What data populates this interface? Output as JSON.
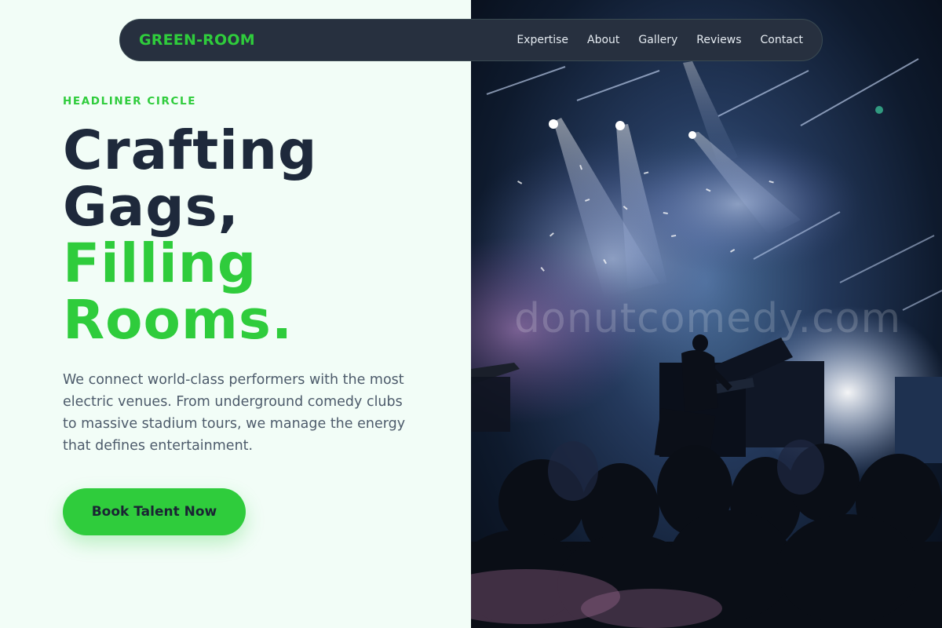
{
  "nav": {
    "logo": "GREEN-ROOM",
    "links": [
      "Expertise",
      "About",
      "Gallery",
      "Reviews",
      "Contact"
    ]
  },
  "hero": {
    "eyebrow": "HEADLINER CIRCLE",
    "headline_dark": [
      "Crafting",
      "Gags,"
    ],
    "headline_green": [
      "Filling",
      "Rooms."
    ],
    "description": "We connect world-class performers with the most electric venues. From underground comedy clubs to massive stadium tours, we manage the energy that defines entertainment.",
    "cta_label": "Book Talent Now"
  },
  "image": {
    "watermark": "donutcomedy.com",
    "subject": "concert-stage-photo"
  },
  "colors": {
    "accent": "#2fcc3c",
    "dark_text": "#1e293b",
    "body_text": "#4d5b6b",
    "background": "#f2fdf7",
    "nav_bg": "#27303f"
  }
}
